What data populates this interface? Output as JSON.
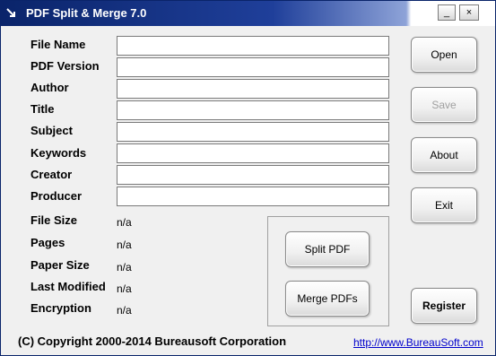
{
  "window": {
    "title": "PDF Split & Merge 7.0"
  },
  "titlebar_buttons": {
    "minimize": "_",
    "close": "×"
  },
  "fields": [
    {
      "label": "File Name",
      "value": ""
    },
    {
      "label": "PDF Version",
      "value": ""
    },
    {
      "label": "Author",
      "value": ""
    },
    {
      "label": "Title",
      "value": ""
    },
    {
      "label": "Subject",
      "value": ""
    },
    {
      "label": "Keywords",
      "value": ""
    },
    {
      "label": "Creator",
      "value": ""
    },
    {
      "label": "Producer",
      "value": ""
    }
  ],
  "info": [
    {
      "label": "File Size",
      "value": "n/a"
    },
    {
      "label": "Pages",
      "value": "n/a"
    },
    {
      "label": "Paper Size",
      "value": "n/a"
    },
    {
      "label": "Last Modified",
      "value": "n/a"
    },
    {
      "label": "Encryption",
      "value": "n/a"
    }
  ],
  "buttons": {
    "open": "Open",
    "save": "Save",
    "about": "About",
    "exit": "Exit",
    "register": "Register",
    "split": "Split PDF",
    "merge": "Merge PDFs"
  },
  "footer": {
    "copyright": "(C) Copyright 2000-2014 Bureausoft Corporation",
    "link": "http://www.BureauSoft.com"
  },
  "colors": {
    "titlebar": "#0a246a",
    "link": "#0000cc",
    "disabled_text": "#a0a0a0"
  }
}
